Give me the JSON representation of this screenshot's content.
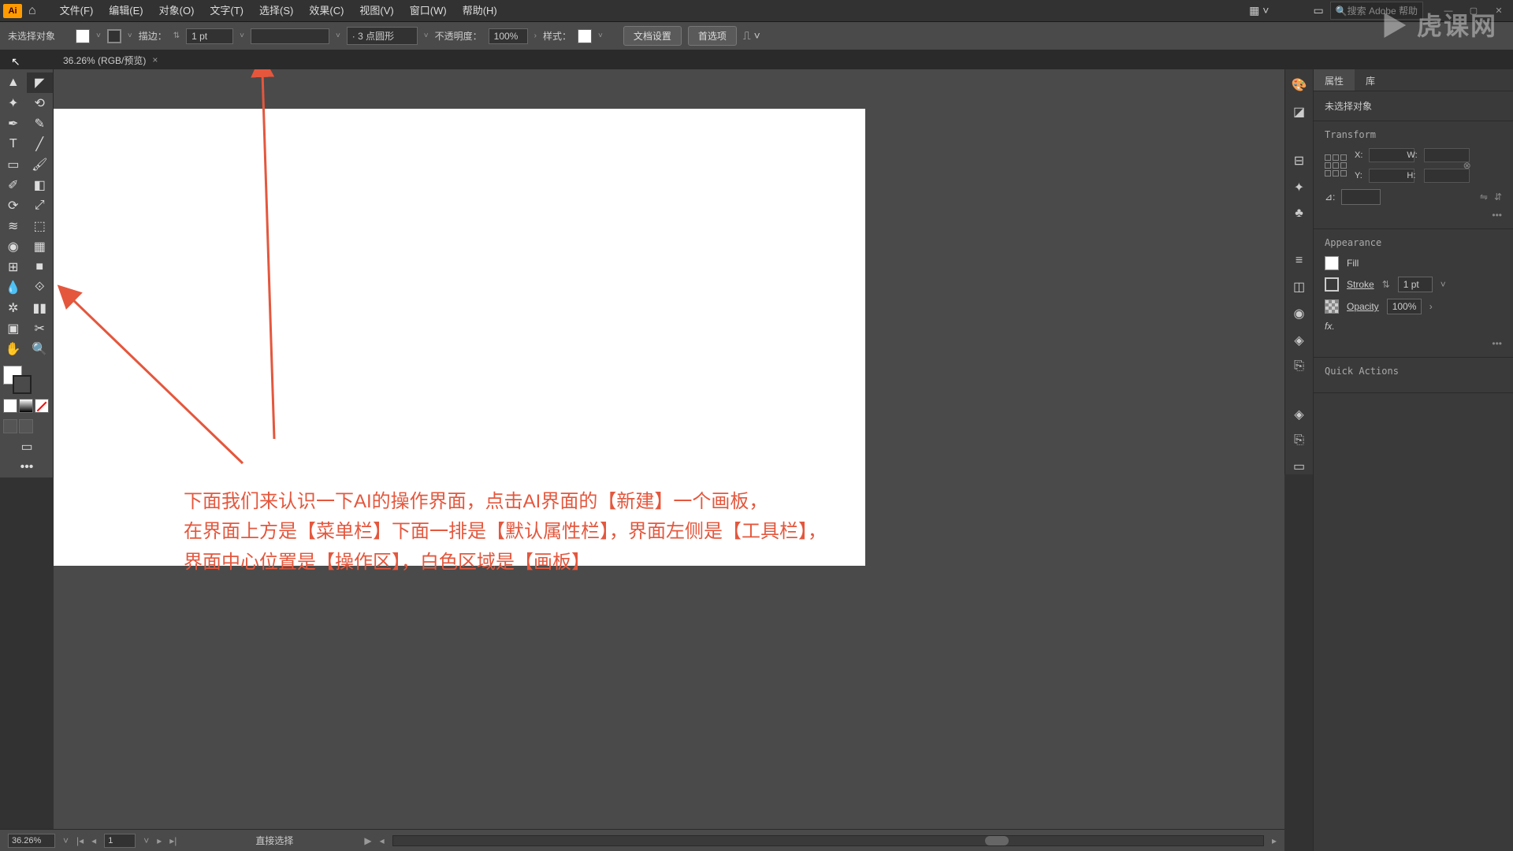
{
  "menubar": {
    "items": [
      "文件(F)",
      "编辑(E)",
      "对象(O)",
      "文字(T)",
      "选择(S)",
      "效果(C)",
      "视图(V)",
      "窗口(W)",
      "帮助(H)"
    ],
    "search_placeholder": "搜索 Adobe 帮助"
  },
  "controlbar": {
    "no_selection": "未选择对象",
    "stroke_label": "描边：",
    "stroke_value": "1 pt",
    "brush_preset": "· 3 点圆形",
    "opacity_label": "不透明度：",
    "opacity_value": "100%",
    "style_label": "样式：",
    "doc_setup": "文档设置",
    "prefs": "首选项"
  },
  "tab": {
    "title": "36.26% (RGB/预览)"
  },
  "annotation": {
    "line1": "下面我们来认识一下AI的操作界面，点击AI界面的【新建】一个画板，",
    "line2": "在界面上方是【菜单栏】下面一排是【默认属性栏】，界面左侧是【工具栏】，",
    "line3": "界面中心位置是【操作区】，白色区域是【画板】"
  },
  "panels": {
    "tab_properties": "属性",
    "tab_library": "库",
    "no_selection": "未选择对象",
    "transform_title": "Transform",
    "appearance_title": "Appearance",
    "fill_label": "Fill",
    "stroke_label": "Stroke",
    "stroke_value": "1 pt",
    "opacity_label": "Opacity",
    "opacity_value": "100%",
    "fx_label": "fx.",
    "quick_actions": "Quick Actions",
    "transform": {
      "x_label": "X:",
      "y_label": "Y:",
      "w_label": "W:",
      "h_label": "H:",
      "angle_label": "⊿:",
      "x": "",
      "y": "",
      "w": "",
      "h": ""
    }
  },
  "statusbar": {
    "zoom": "36.26%",
    "artboard": "1",
    "tool_hint": "直接选择"
  },
  "watermark": "▶ 虎课网"
}
